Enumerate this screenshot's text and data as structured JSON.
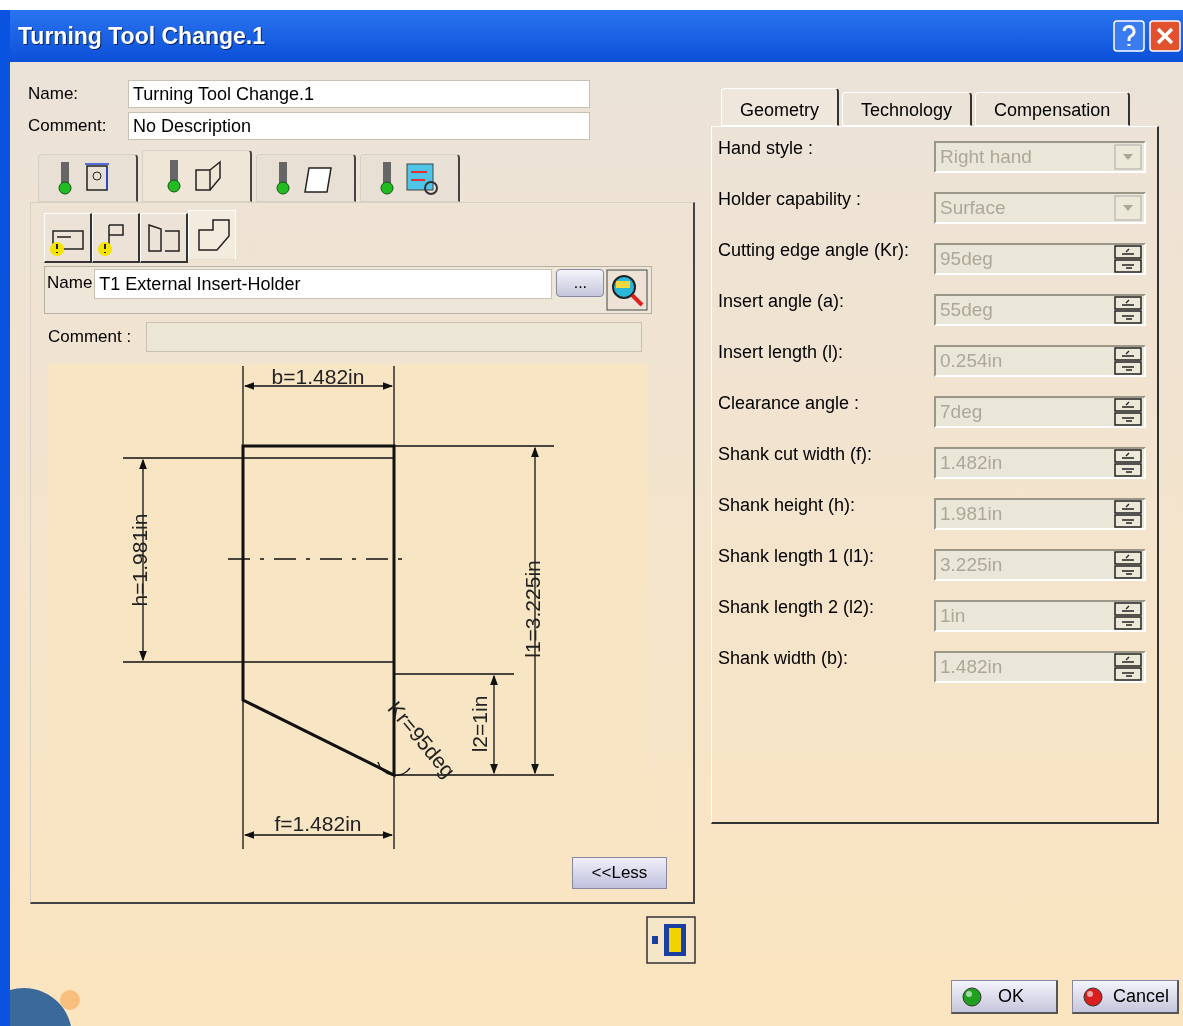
{
  "window": {
    "title": "Turning Tool Change.1"
  },
  "header_fields": [
    {
      "label": "Name:",
      "value": "Turning Tool Change.1"
    },
    {
      "label": "Comment:",
      "value": "No Description"
    }
  ],
  "tool_tabs": [
    {
      "selected": false
    },
    {
      "selected": true
    },
    {
      "selected": false
    },
    {
      "selected": false
    }
  ],
  "sub_tabs": [
    {
      "selected": false,
      "warning": true
    },
    {
      "selected": false,
      "warning": true
    },
    {
      "selected": false,
      "warning": false
    },
    {
      "selected": true,
      "warning": false
    }
  ],
  "holder": {
    "name_label": "Name",
    "name_value": "T1 External Insert-Holder",
    "browse_button": "...",
    "comment_label": "Comment :",
    "comment_disabled": true
  },
  "drawing": {
    "b": "b=1.482in",
    "h": "h=1.981in",
    "l1": "l1=3.225in",
    "l2": "l2=1in",
    "kr": "Kr=95deg",
    "f": "f=1.482in"
  },
  "less_button": "<<Less",
  "param_tabs": [
    {
      "label": "Geometry",
      "selected": true
    },
    {
      "label": "Technology",
      "selected": false
    },
    {
      "label": "Compensation",
      "selected": false
    }
  ],
  "params": [
    {
      "label": "Hand style :",
      "value": "Right hand",
      "kind": "dropdown",
      "disabled": true
    },
    {
      "label": "Holder capability :",
      "value": "Surface",
      "kind": "dropdown",
      "disabled": true
    },
    {
      "label": "Cutting edge angle (Kr):",
      "value": "95deg",
      "kind": "spinner",
      "disabled": true
    },
    {
      "label": "Insert angle (a):",
      "value": "55deg",
      "kind": "spinner",
      "disabled": true
    },
    {
      "label": "Insert length (l):",
      "value": "0.254in",
      "kind": "spinner",
      "disabled": true
    },
    {
      "label": "Clearance angle :",
      "value": "7deg",
      "kind": "spinner",
      "disabled": true
    },
    {
      "label": "Shank cut width (f):",
      "value": "1.482in",
      "kind": "spinner",
      "disabled": true
    },
    {
      "label": "Shank height (h):",
      "value": "1.981in",
      "kind": "spinner",
      "disabled": true
    },
    {
      "label": "Shank length 1 (l1):",
      "value": "3.225in",
      "kind": "spinner",
      "disabled": true
    },
    {
      "label": "Shank length 2 (l2):",
      "value": "1in",
      "kind": "spinner",
      "disabled": true
    },
    {
      "label": "Shank width (b):",
      "value": "1.482in",
      "kind": "spinner",
      "disabled": true
    }
  ],
  "buttons": [
    {
      "label": "OK",
      "kind": "ok"
    },
    {
      "label": "Cancel",
      "kind": "cancel"
    }
  ]
}
